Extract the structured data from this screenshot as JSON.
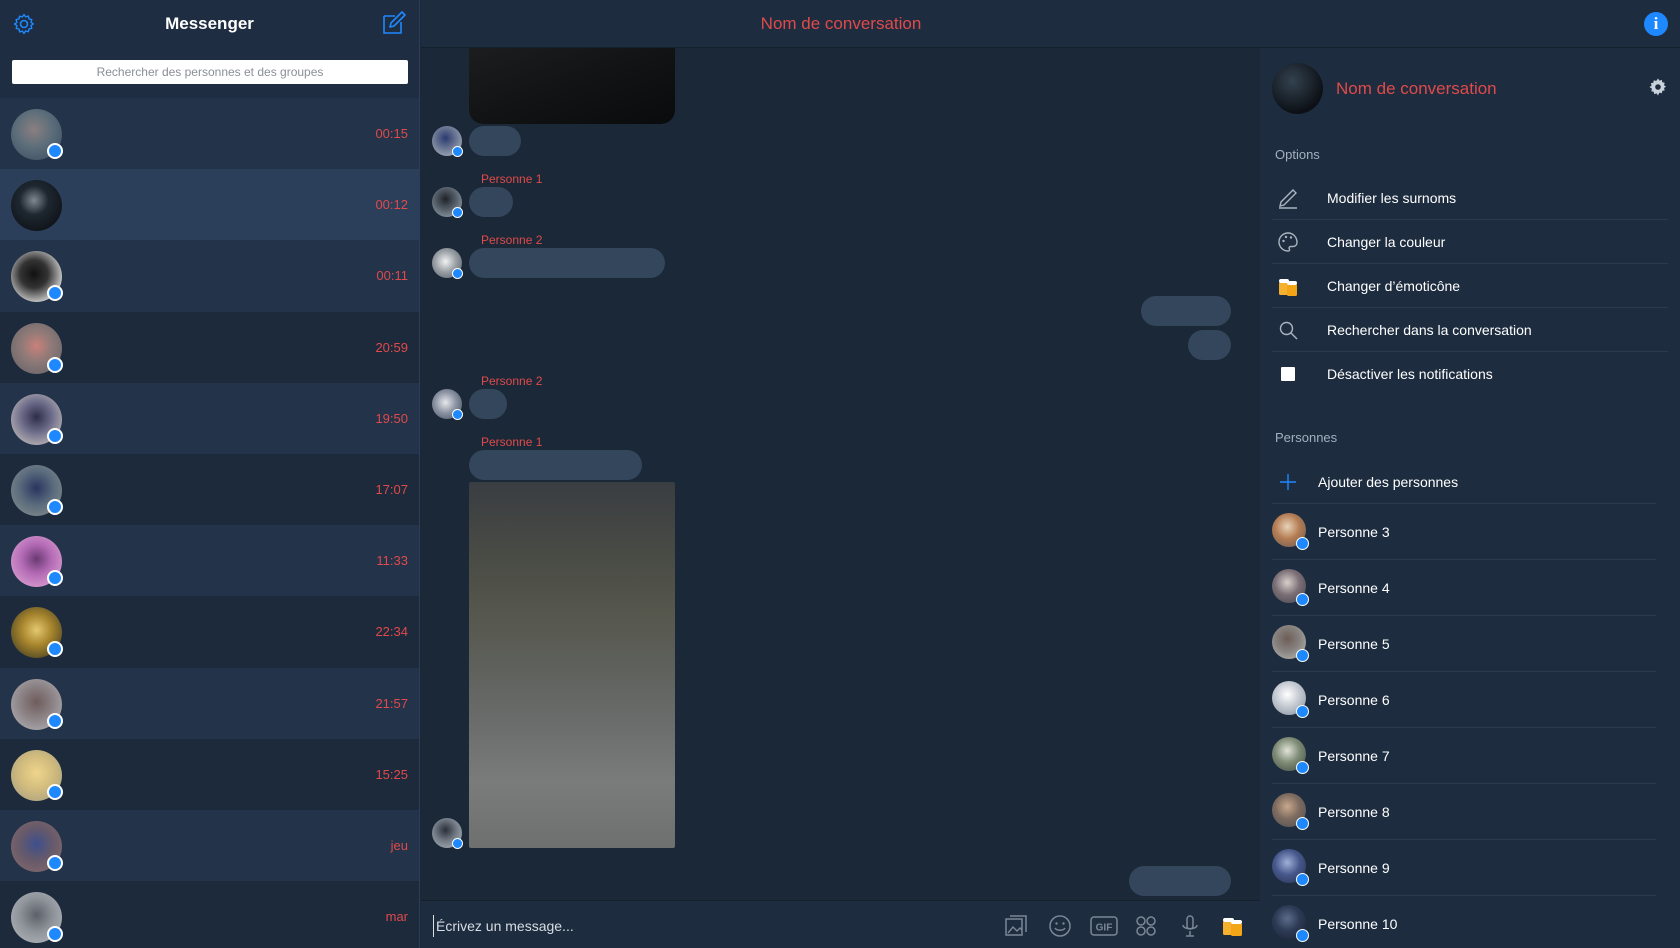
{
  "sidebar": {
    "title": "Messenger",
    "search_placeholder": "Rechercher des personnes et des groupes",
    "conversations": [
      {
        "time": "00:15"
      },
      {
        "time": "00:12"
      },
      {
        "time": "00:11"
      },
      {
        "time": "20:59"
      },
      {
        "time": "19:50"
      },
      {
        "time": "17:07"
      },
      {
        "time": "11:33"
      },
      {
        "time": "22:34"
      },
      {
        "time": "21:57"
      },
      {
        "time": "15:25"
      },
      {
        "time": "jeu"
      },
      {
        "time": "mar"
      }
    ]
  },
  "header": {
    "title": "Nom de conversation",
    "info_icon": "info-icon",
    "info_glyph": "i"
  },
  "chat": {
    "senders": [
      "Personne 1",
      "Personne 2",
      "Personne 2",
      "Personne 1"
    ]
  },
  "composer": {
    "placeholder": "Écrivez un message...",
    "gif_label": "GIF"
  },
  "details": {
    "name": "Nom de conversation",
    "options_label": "Options",
    "options": [
      {
        "label": "Modifier les surnoms",
        "icon": "pencil-icon"
      },
      {
        "label": "Changer la couleur",
        "icon": "palette-icon"
      },
      {
        "label": "Changer d’émoticône",
        "icon": "beer-icon"
      },
      {
        "label": "Rechercher dans la conversation",
        "icon": "search-icon"
      },
      {
        "label": "Désactiver les notifications",
        "icon": "checkbox-icon"
      }
    ],
    "people_label": "Personnes",
    "add_people": "Ajouter des personnes",
    "people": [
      "Personne 3",
      "Personne 4",
      "Personne 5",
      "Personne 6",
      "Personne 7",
      "Personne 8",
      "Personne 9",
      "Personne 10"
    ]
  },
  "colors": {
    "accent": "#e04a4a",
    "brand_blue": "#1e88ff",
    "background": "#1b2838"
  }
}
